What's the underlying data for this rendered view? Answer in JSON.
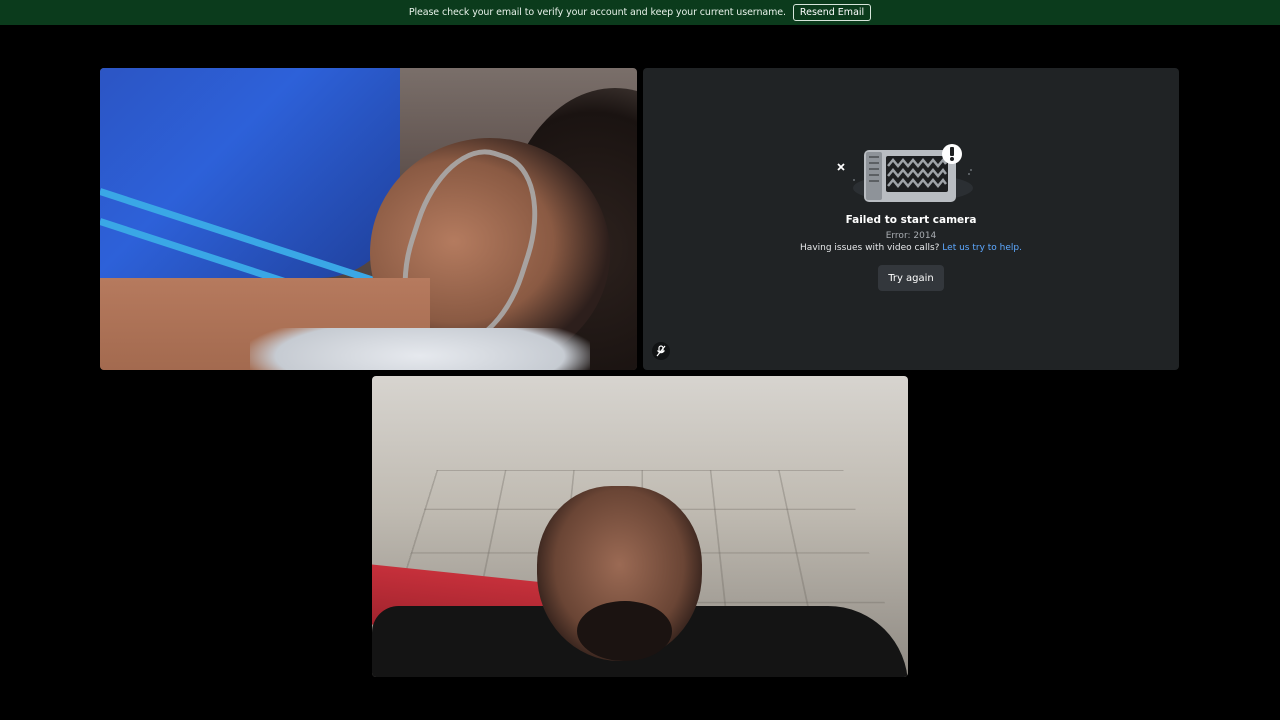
{
  "banner": {
    "message": "Please check your email to verify your account and keep your current username.",
    "button_label": "Resend Email"
  },
  "tiles": {
    "error": {
      "title": "Failed to start camera",
      "code": "Error: 2014",
      "help_prefix": "Having issues with video calls?",
      "help_link": "Let us try to help.",
      "retry_label": "Try again",
      "muted_icon": "mic-muted-icon"
    }
  },
  "colors": {
    "banner_bg": "#0b3b1c",
    "tile_bg": "#202325",
    "link": "#5da8ff",
    "button_bg": "#33373c"
  }
}
